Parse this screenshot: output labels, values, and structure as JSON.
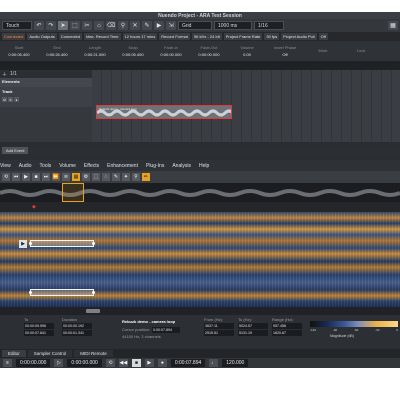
{
  "window": {
    "title": "Nuendo Project - ARA Test Session"
  },
  "toolbar": {
    "touch_mode": "Touch",
    "grid_label": "Grid",
    "grid_value": "1000 ms",
    "quantize": "1/16"
  },
  "infobar": [
    {
      "text": "Connected",
      "hl": true
    },
    {
      "text": "Audio Outputs",
      "hl": false
    },
    {
      "text": "Connected",
      "hl": false
    },
    {
      "text": "Max. Record Time",
      "hl": false
    },
    {
      "text": "12 hours 17 mins",
      "hl": false
    },
    {
      "text": "Record Format",
      "hl": false
    },
    {
      "text": "96 kHz - 24 bit",
      "hl": false
    },
    {
      "text": "Project Frame Rate",
      "hl": false
    },
    {
      "text": "30 fps",
      "hl": false
    },
    {
      "text": "Project Audio Pull",
      "hl": false
    },
    {
      "text": "Off",
      "hl": false
    }
  ],
  "inspector": [
    {
      "label": "Start",
      "value": "0:00:05.400"
    },
    {
      "label": "End",
      "value": "0:00:26.400"
    },
    {
      "label": "Length",
      "value": "0:00:21.000"
    },
    {
      "label": "Snap",
      "value": "0:00:05.400"
    },
    {
      "label": "Fade-In",
      "value": "0:00:00.000"
    },
    {
      "label": "Fade-Out",
      "value": "0:00:00.000"
    },
    {
      "label": "Volume",
      "value": "0.00"
    },
    {
      "label": "Invert Phase",
      "value": "Off"
    },
    {
      "label": "Mute",
      "value": ""
    },
    {
      "label": "Lock",
      "value": ""
    }
  ],
  "tracks": {
    "header": "Elements",
    "name": "Track",
    "counter": "1/1"
  },
  "event": {
    "label": "Rebuzk demo - camera loop"
  },
  "add_event": "Add Event",
  "menu": [
    "View",
    "Audio",
    "Tools",
    "Volume",
    "Effects",
    "Enhancement",
    "Plug-Ins",
    "Analysis",
    "Help"
  ],
  "info_panel": {
    "cols": [
      {
        "label": "To",
        "values": [
          "00:00:09.596",
          "00:00:07.841"
        ]
      },
      {
        "label": "Duration",
        "values": [
          "00:00:00.192",
          "00:00:01.341"
        ]
      },
      {
        "label": "From (Hz):",
        "values": [
          "3637.11",
          "2515.51"
        ]
      },
      {
        "label": "To (Hz):",
        "values": [
          "5024.57",
          "5131.19"
        ]
      },
      {
        "label": "Range (Hz):",
        "values": [
          "957.456",
          "1620.67"
        ]
      }
    ],
    "file_title": "Rebuzk demo - camera loop",
    "cursor_label": "Cursor position:",
    "cursor_value": "0:00:07.894",
    "file_format": "44100 Hz, 2 channels",
    "colorbar_ticks": [
      "-120",
      "-90",
      "-60",
      "-30",
      "0"
    ],
    "magnitude_label": "Magnitude (dB)"
  },
  "tabs": [
    "Editor",
    "Sampler Control",
    "MIDI Remote"
  ],
  "bottom": {
    "time_left": "0:00:00.000",
    "time_mid": "0:00:00.000",
    "time_right": "0:00:07.894",
    "tempo": "120.000"
  }
}
